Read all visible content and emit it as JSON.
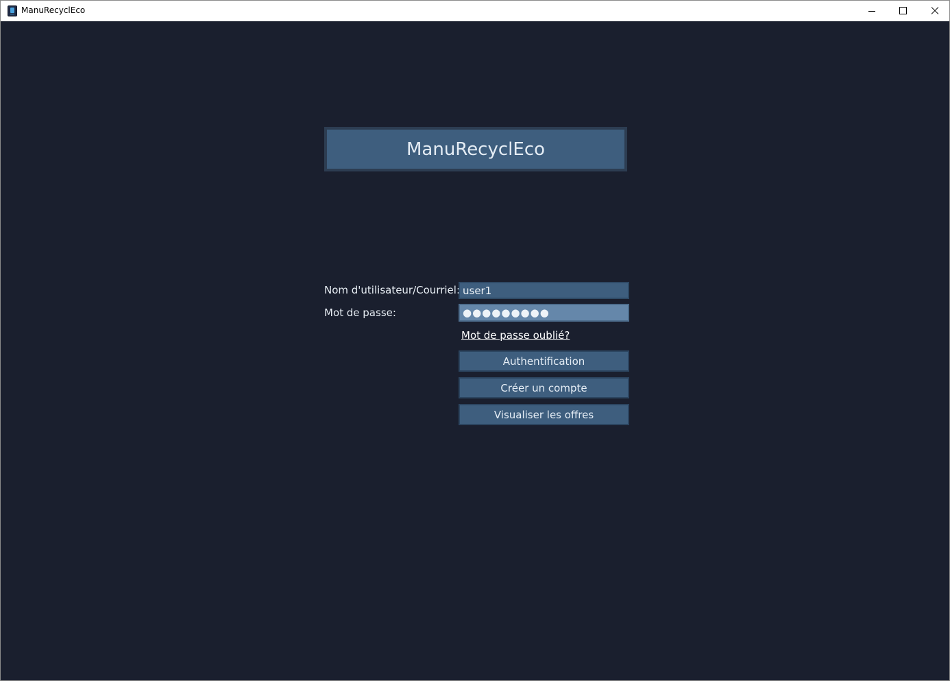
{
  "window": {
    "title": "ManuRecyclEco",
    "icon": "app-icon",
    "controls": [
      "minimize-icon",
      "maximize-icon",
      "close-icon"
    ]
  },
  "header": {
    "title": "ManuRecyclEco"
  },
  "login": {
    "username_label": "Nom d'utilisateur/Courriel:",
    "username_value": "user1",
    "password_label": "Mot de passe:",
    "password_value": "●●●●●●●●●",
    "forgot_password": "Mot de passe oublié?"
  },
  "actions": {
    "authenticate": "Authentification",
    "create_account": "Créer un compte",
    "view_offers": "Visualiser les offres"
  },
  "colors": {
    "background": "#1a1f2e",
    "panel": "#3e5e7e",
    "field_focused": "#6587aa",
    "text": "#e8eef4"
  }
}
